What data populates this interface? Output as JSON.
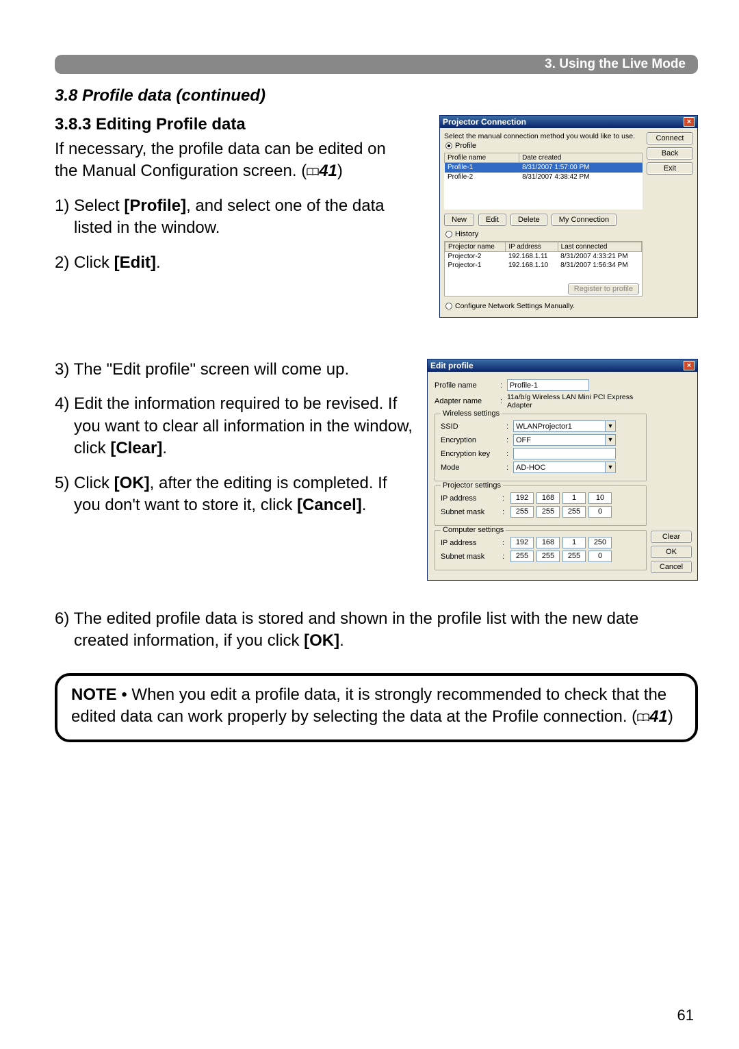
{
  "section_bar": "3. Using the Live Mode",
  "subtitle": "3.8 Profile data (continued)",
  "heading": "3.8.3 Editing Profile data",
  "intro_line1": "If necessary, the profile data can be edited on",
  "intro_line2_a": "the Manual Configuration screen. (",
  "intro_line2_ref": "41",
  "intro_line2_b": ")",
  "step1_a": "1) Select ",
  "step1_b": "[Profile]",
  "step1_c": ", and select one of the data listed in the window.",
  "step2_a": "2) Click ",
  "step2_b": "[Edit]",
  "step2_c": ".",
  "step3": "3) The \"Edit profile\" screen will come up.",
  "step4_a": "4) Edit the information required to be revised. If you want to clear all information in the window, click ",
  "step4_b": "[Clear]",
  "step4_c": ".",
  "step5_a": "5) Click ",
  "step5_b": "[OK]",
  "step5_c": ", after the editing is completed. If you don't want to store it, click ",
  "step5_d": "[Cancel]",
  "step5_e": ".",
  "step6_a": "6) The edited profile data is stored and shown in the profile list with the new date created information, if you click ",
  "step6_b": "[OK]",
  "step6_c": ".",
  "note_label": "NOTE",
  "note_body_a": " • When you edit a profile data, it is strongly recommended to check that the edited data can work properly by selecting the data at the Profile connection. (",
  "note_ref": "41",
  "note_body_b": ")",
  "page_number": "61",
  "dlg1": {
    "title": "Projector Connection",
    "instruction": "Select the manual connection method you would like to use.",
    "radio_profile": "Profile",
    "col_profile_name": "Profile name",
    "col_date_created": "Date created",
    "profiles": [
      {
        "name": "Profile-1",
        "date": "8/31/2007 1:57:00 PM",
        "selected": true
      },
      {
        "name": "Profile-2",
        "date": "8/31/2007 4:38:42 PM",
        "selected": false
      }
    ],
    "btn_new": "New",
    "btn_edit": "Edit",
    "btn_delete": "Delete",
    "btn_myconn": "My Connection",
    "radio_history": "History",
    "hist_col_name": "Projector name",
    "hist_col_ip": "IP address",
    "hist_col_last": "Last connected",
    "history": [
      {
        "name": "Projector-2",
        "ip": "192.168.1.11",
        "last": "8/31/2007 4:33:21 PM"
      },
      {
        "name": "Projector-1",
        "ip": "192.168.1.10",
        "last": "8/31/2007 1:56:34 PM"
      }
    ],
    "btn_register": "Register to profile",
    "radio_manual": "Configure Network Settings Manually.",
    "btn_connect": "Connect",
    "btn_back": "Back",
    "btn_exit": "Exit"
  },
  "dlg2": {
    "title": "Edit profile",
    "lbl_profile_name": "Profile name",
    "val_profile_name": "Profile-1",
    "lbl_adapter": "Adapter name",
    "val_adapter": "11a/b/g Wireless LAN Mini PCI Express Adapter",
    "grp_wireless": "Wireless settings",
    "lbl_ssid": "SSID",
    "val_ssid": "WLANProjector1",
    "lbl_enc": "Encryption",
    "val_enc": "OFF",
    "lbl_enckey": "Encryption key",
    "val_enckey": "",
    "lbl_mode": "Mode",
    "val_mode": "AD-HOC",
    "grp_projector": "Projector settings",
    "lbl_ip": "IP address",
    "proj_ip": [
      "192",
      "168",
      "1",
      "10"
    ],
    "lbl_mask": "Subnet mask",
    "proj_mask": [
      "255",
      "255",
      "255",
      "0"
    ],
    "grp_computer": "Computer settings",
    "comp_ip": [
      "192",
      "168",
      "1",
      "250"
    ],
    "comp_mask": [
      "255",
      "255",
      "255",
      "0"
    ],
    "btn_clear": "Clear",
    "btn_ok": "OK",
    "btn_cancel": "Cancel"
  }
}
